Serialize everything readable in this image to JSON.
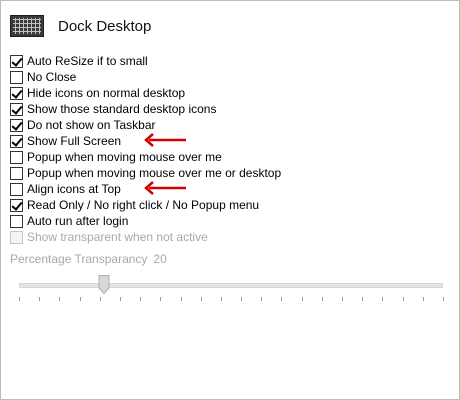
{
  "app": {
    "title": "Dock Desktop",
    "icon": "desktop-grid-icon"
  },
  "options": [
    {
      "label": "Auto ReSize if to small",
      "checked": true,
      "disabled": false,
      "annotated": false
    },
    {
      "label": "No Close",
      "checked": false,
      "disabled": false,
      "annotated": false
    },
    {
      "label": "Hide icons on normal desktop",
      "checked": true,
      "disabled": false,
      "annotated": false
    },
    {
      "label": "Show those standard desktop icons",
      "checked": true,
      "disabled": false,
      "annotated": false
    },
    {
      "label": "Do not show on Taskbar",
      "checked": true,
      "disabled": false,
      "annotated": false
    },
    {
      "label": "Show Full Screen",
      "checked": true,
      "disabled": false,
      "annotated": true
    },
    {
      "label": "Popup when moving mouse over me",
      "checked": false,
      "disabled": false,
      "annotated": false
    },
    {
      "label": "Popup when moving mouse over me or desktop",
      "checked": false,
      "disabled": false,
      "annotated": false
    },
    {
      "label": "Align icons at Top",
      "checked": false,
      "disabled": false,
      "annotated": true
    },
    {
      "label": "Read Only / No right click / No Popup menu",
      "checked": true,
      "disabled": false,
      "annotated": false
    },
    {
      "label": "Auto run after login",
      "checked": false,
      "disabled": false,
      "annotated": false
    },
    {
      "label": "Show transparent when not active",
      "checked": false,
      "disabled": true,
      "annotated": false
    }
  ],
  "transparency": {
    "label": "Percentage Transparancy",
    "value": "20",
    "slider_min": 0,
    "slider_max": 100,
    "slider_value": 20,
    "tick_count": 22,
    "disabled": true
  },
  "colors": {
    "annotation_arrow": "#d40000",
    "disabled_text": "#a8a8a8"
  }
}
